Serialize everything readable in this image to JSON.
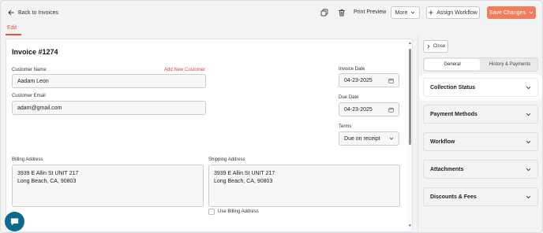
{
  "header": {
    "back_label": "Back to Invoices",
    "print_label": "Print Preview",
    "more_label": "More",
    "assign_label": "Assign Workflow",
    "save_label": "Save Changes",
    "edit_tab": "Edit"
  },
  "invoice": {
    "title": "Invoice #1274",
    "customer_name_label": "Customer Name",
    "add_new_customer": "Add New Customer",
    "customer_name": "Aadam Leon",
    "customer_email_label": "Customer Email",
    "customer_email": "adam@gmail.com",
    "invoice_date_label": "Invoice Date",
    "invoice_date": "04-23-2025",
    "due_date_label": "Due Date",
    "due_date": "04-23-2025",
    "terms_label": "Terms",
    "terms_value": "Due on receipt",
    "billing_label": "Billing Address",
    "billing_line1": "3939 E Allin St UNIT 217",
    "billing_line2": "Long Beach, CA, 90803",
    "shipping_label": "Shipping Address",
    "shipping_line1": "3939 E Allin St UNIT 217",
    "shipping_line2": "Long Beach, CA, 90803",
    "use_billing_label": "Use Billing Address"
  },
  "sidebar": {
    "close_label": "Close",
    "tabs": [
      "General",
      "History & Payments"
    ],
    "sections": [
      "Collection Status",
      "Payment Methods",
      "Workflow",
      "Attachments",
      "Discounts & Fees"
    ]
  },
  "colors": {
    "accent": "#e2573b",
    "save_button": "#ef7d5f",
    "chat_bubble": "#0e6a8c"
  }
}
